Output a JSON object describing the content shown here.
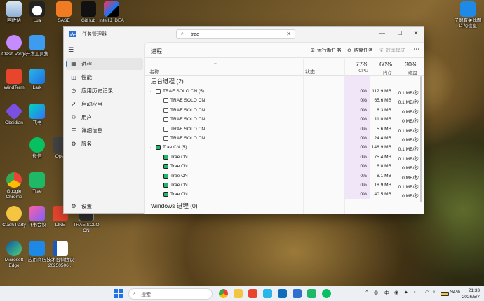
{
  "desktop_icons": [
    {
      "label": "回收站"
    },
    {
      "label": "Lua"
    },
    {
      "label": "SASE"
    },
    {
      "label": "GitHub"
    },
    {
      "label": "IntelliJ IDEA"
    },
    {
      "label": "Clash Verge"
    },
    {
      "label": "开发工具集"
    },
    {
      "label": "WindTerm"
    },
    {
      "label": "Lark"
    },
    {
      "label": "Obsidian"
    },
    {
      "label": "飞书"
    },
    {
      "label": "微信"
    },
    {
      "label": "Oper"
    },
    {
      "label": "Google Chrome"
    },
    {
      "label": "Trae"
    },
    {
      "label": "Clash Party"
    },
    {
      "label": "飞书会议"
    },
    {
      "label": "LINE"
    },
    {
      "label": "TRAE SOLO CN"
    },
    {
      "label": "Microsoft Edge"
    },
    {
      "label": "应用商店"
    },
    {
      "label": "技术合伙协议 20250506..."
    },
    {
      "label": "了解有关此图片的信息"
    }
  ],
  "window": {
    "app_title": "任务管理器",
    "search_value": "trae",
    "minimize": "—",
    "maximize": "☐",
    "close": "✕"
  },
  "sidebar": {
    "items": [
      {
        "label": "进程",
        "icon": "processes-icon",
        "glyph": "▦"
      },
      {
        "label": "性能",
        "icon": "performance-icon",
        "glyph": "◫"
      },
      {
        "label": "应用历史记录",
        "icon": "app-history-icon",
        "glyph": "◷"
      },
      {
        "label": "启动应用",
        "icon": "startup-icon",
        "glyph": "➚"
      },
      {
        "label": "用户",
        "icon": "users-icon",
        "glyph": "⚇"
      },
      {
        "label": "详细信息",
        "icon": "details-icon",
        "glyph": "☰"
      },
      {
        "label": "服务",
        "icon": "services-icon",
        "glyph": "⚙"
      }
    ],
    "settings": {
      "label": "设置",
      "glyph": "⚙"
    }
  },
  "main": {
    "page_title": "进程",
    "run_task": "运行新任务",
    "end_task": "结束任务",
    "efficiency": "效率模式",
    "more": "⋯"
  },
  "columns": {
    "name": "名称",
    "status": "状态",
    "cpu": {
      "pct": "77%",
      "label": "CPU"
    },
    "memory": {
      "pct": "60%",
      "label": "内存"
    },
    "disk": {
      "pct": "30%",
      "label": "磁盘"
    }
  },
  "groups": {
    "background": "后台进程 (2)",
    "windows": "Windows 进程 (0)"
  },
  "rows": [
    {
      "name": "TRAE SOLO CN (5)",
      "cpu": "0%",
      "mem": "112.9 MB",
      "disk": "0.1 MB/秒"
    },
    {
      "name": "TRAE SOLO CN",
      "cpu": "0%",
      "mem": "65.6 MB",
      "disk": "0.1 MB/秒"
    },
    {
      "name": "TRAE SOLO CN",
      "cpu": "0%",
      "mem": "6.3 MB",
      "disk": "0 MB/秒"
    },
    {
      "name": "TRAE SOLO CN",
      "cpu": "0%",
      "mem": "11.0 MB",
      "disk": "0 MB/秒"
    },
    {
      "name": "TRAE SOLO CN",
      "cpu": "0%",
      "mem": "5.6 MB",
      "disk": "0.1 MB/秒"
    },
    {
      "name": "TRAE SOLO CN",
      "cpu": "0%",
      "mem": "24.4 MB",
      "disk": "0 MB/秒"
    },
    {
      "name": "Trae CN (5)",
      "cpu": "0%",
      "mem": "148.9 MB",
      "disk": "0.1 MB/秒"
    },
    {
      "name": "Trae CN",
      "cpu": "0%",
      "mem": "75.4 MB",
      "disk": "0.1 MB/秒"
    },
    {
      "name": "Trae CN",
      "cpu": "0%",
      "mem": "6.0 MB",
      "disk": "0 MB/秒"
    },
    {
      "name": "Trae CN",
      "cpu": "0%",
      "mem": "8.1 MB",
      "disk": "0 MB/秒"
    },
    {
      "name": "Trae CN",
      "cpu": "0%",
      "mem": "18.9 MB",
      "disk": "0.1 MB/秒"
    },
    {
      "name": "Trae CN",
      "cpu": "0%",
      "mem": "40.5 MB",
      "disk": "0 MB/秒"
    }
  ],
  "taskbar": {
    "search_placeholder": "搜索",
    "ime": "中",
    "battery": "94%",
    "time": "21:33",
    "date": "2026/5/7"
  },
  "colors": {
    "accent": "#2e6fd0",
    "cpu_highlight": "#f1e5f8",
    "trae_solo": "#555555",
    "trae_cn": "#1fb866"
  }
}
